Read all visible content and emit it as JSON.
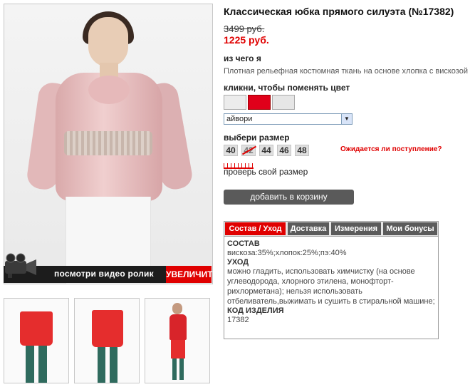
{
  "product": {
    "title": "Классическая юбка прямого силуэта (№17382)",
    "old_price": "3499 руб.",
    "new_price": "1225 руб."
  },
  "media": {
    "video_label": "посмотри видео ролик",
    "zoom_label": "УВЕЛИЧИТЬ"
  },
  "material": {
    "label": "из чего я",
    "text": "Плотная рельефная костюмная ткань на основе хлопка с вискозой"
  },
  "color": {
    "label": "кликни, чтобы поменять цвет",
    "swatches": [
      "#ececec",
      "#e0001a",
      "#e6e6e6"
    ],
    "selected": "айвори"
  },
  "size": {
    "label": "выбери размер",
    "options": [
      "40",
      "42",
      "44",
      "46",
      "48"
    ],
    "unavailable": "42",
    "waiting_link": "Ожидается ли поступление?",
    "check_size": "проверь свой размер"
  },
  "cart": {
    "button": "добавить в корзину"
  },
  "tabs": [
    "Состав / Уход",
    "Доставка",
    "Измерения",
    "Мои бонусы"
  ],
  "details": {
    "composition_head": "СОСТАВ",
    "composition": "вискоза:35%;хлопок:25%;пэ:40%",
    "care_head": "УХОД",
    "care": "можно гладить, использовать химчистку (на основе углеводорода, хлорного этилена, монофторт­рихлорметана); нельзя использовать отбеливатель,выжимать и сушить в стиральной машине;",
    "code_head": "КОД ИЗДЕЛИЯ",
    "code": "17382"
  },
  "colors": {
    "accent": "#e00000",
    "button": "#5a5a5a",
    "skirt": "#e52d2d"
  }
}
